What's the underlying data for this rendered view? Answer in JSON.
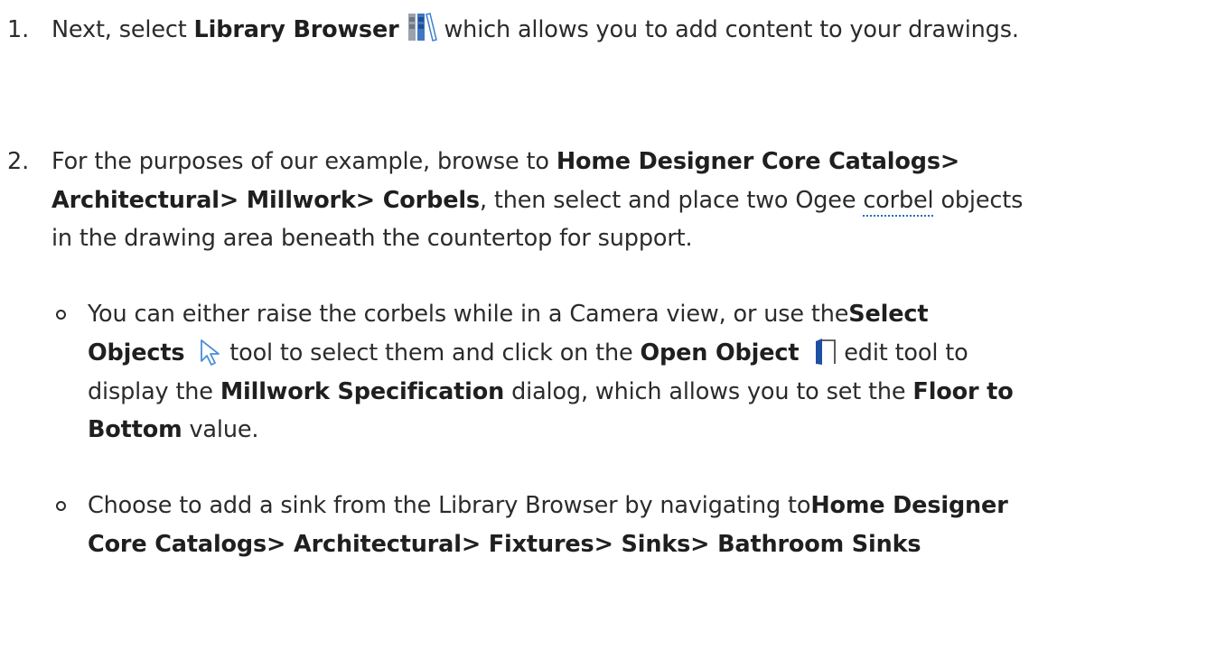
{
  "step1": {
    "number": "1.",
    "lead": "Next, select ",
    "bold": "Library Browser",
    "icon": "library-browser-icon",
    "rest": " which allows you to add content to your drawings."
  },
  "step2": {
    "number": "2.",
    "line1_text": "For the purposes of our example, browse to",
    "line1_bold": "Home Designer Core Catalogs>",
    "line2_bold": "Architectural> Millwork> Corbels",
    "line2_text": ", then select and place two Ogee ",
    "line2_link": "corbel",
    "line2_end": " objects",
    "line3_text": "in the drawing area beneath the countertop for support."
  },
  "bullet1": {
    "line1_text": "You can either raise the corbels while in a Camera view, or use the",
    "line1_bold": "Select",
    "line2_bold1": "Objects",
    "select_icon": "select-objects-arrow-icon",
    "line2_text1": " tool to select them and click on the",
    "line2_bold2": "Open Object",
    "open_icon": "open-object-icon",
    "line2_text2": " edit tool to",
    "line3_text1": "display the ",
    "line3_bold": "Millwork Specification",
    "line3_text2": " dialog, which allows you to set the ",
    "line3_bold2": "Floor to",
    "line4_bold": "Bottom",
    "line4_text": " value."
  },
  "bullet2": {
    "line1_text": "Choose to add a sink from the Library Browser by navigating to",
    "line1_bold": "Home Designer",
    "line2_bold": "Core Catalogs> Architectural> Fixtures> Sinks> Bathroom Sinks"
  }
}
